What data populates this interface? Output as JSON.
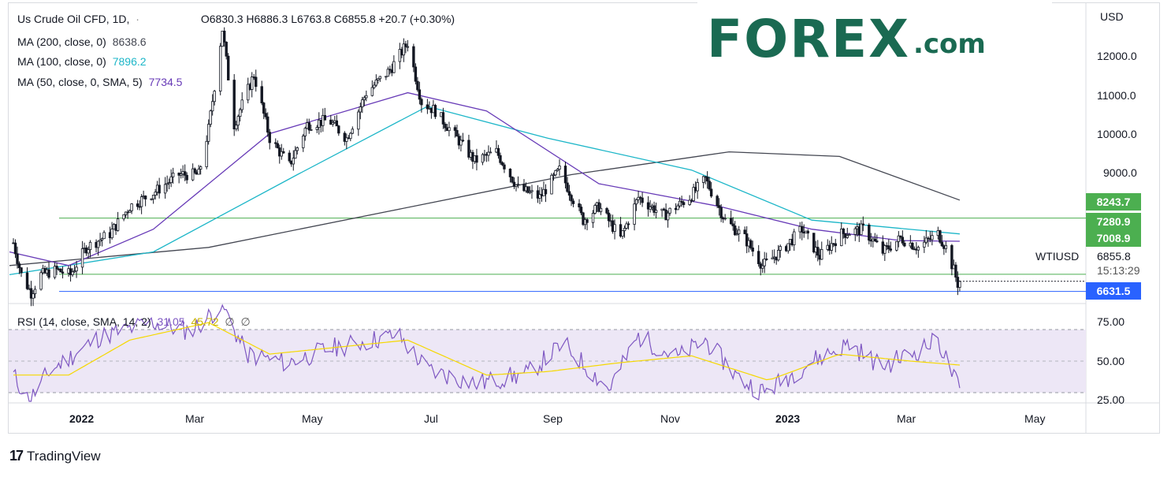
{
  "header": {
    "symbol": "Us Crude Oil CFD, 1D,",
    "dot": "·",
    "ohlc": "O6830.3  H6886.3  L6763.8  C6855.8  +20.7 (+0.30%)"
  },
  "indicators": [
    {
      "label": "MA (200, close, 0)",
      "value": "8638.6",
      "color": "#434651"
    },
    {
      "label": "MA (100, close, 0)",
      "value": "7896.2",
      "color": "#1cb6c8"
    },
    {
      "label": "MA (50, close, 0, SMA, 5)",
      "value": "7734.5",
      "color": "#673ab7"
    }
  ],
  "rsi_legend": {
    "label": "RSI (14, close, SMA, 14, 2)",
    "v1": "31.05",
    "v2": "45.72",
    "v3": "∅",
    "v4": "∅"
  },
  "brand": {
    "logo": "FOREX",
    "suffix": ".com",
    "color": "#1a6a52"
  },
  "axis": {
    "currency": "USD",
    "price_ticks": [
      "12000.0",
      "11000.0",
      "10000.0",
      "9000.0"
    ],
    "rsi_ticks": [
      "75.00",
      "50.00",
      "25.00"
    ],
    "time_ticks": [
      "2022",
      "Mar",
      "May",
      "Jul",
      "Sep",
      "Nov",
      "2023",
      "Mar",
      "May"
    ]
  },
  "price_boxes": [
    {
      "label": "8243.7",
      "color": "#4caf50"
    },
    {
      "label": "7280.9",
      "color": "#4caf50"
    },
    {
      "label": "7008.9",
      "color": "#4caf50"
    },
    {
      "label": "6631.5",
      "color": "#2962ff"
    }
  ],
  "last_price": {
    "symbol": "WTIUSD",
    "price": "6855.8",
    "countdown": "15:13:29"
  },
  "footer": {
    "brand": "TradingView"
  },
  "chart_data": {
    "type": "candlestick",
    "timeframe": "1D",
    "y_range": [
      6400,
      12900
    ],
    "x_range": [
      "2021-11-20",
      "2023-05-20"
    ],
    "horizontal_levels": [
      {
        "value": 8243.7,
        "color": "#4caf50"
      },
      {
        "value": 7008.9,
        "color": "#4caf50"
      },
      {
        "value": 6631.5,
        "color": "#2962ff"
      }
    ],
    "close_path": [
      [
        "2021-11-22",
        7700
      ],
      [
        "2021-11-26",
        7000
      ],
      [
        "2021-12-01",
        6600
      ],
      [
        "2021-12-06",
        7000
      ],
      [
        "2021-12-14",
        7100
      ],
      [
        "2021-12-21",
        7000
      ],
      [
        "2021-12-29",
        7600
      ],
      [
        "2022-01-10",
        7900
      ],
      [
        "2022-01-20",
        8500
      ],
      [
        "2022-02-01",
        8800
      ],
      [
        "2022-02-14",
        9200
      ],
      [
        "2022-02-24",
        9200
      ],
      [
        "2022-03-01",
        10200
      ],
      [
        "2022-03-08",
        12400
      ],
      [
        "2022-03-14",
        10300
      ],
      [
        "2022-03-24",
        11400
      ],
      [
        "2022-04-01",
        10000
      ],
      [
        "2022-04-11",
        9400
      ],
      [
        "2022-04-20",
        10300
      ],
      [
        "2022-05-01",
        10400
      ],
      [
        "2022-05-10",
        10000
      ],
      [
        "2022-05-20",
        11000
      ],
      [
        "2022-06-01",
        11500
      ],
      [
        "2022-06-10",
        12100
      ],
      [
        "2022-06-17",
        10800
      ],
      [
        "2022-06-24",
        10600
      ],
      [
        "2022-07-05",
        10000
      ],
      [
        "2022-07-14",
        9500
      ],
      [
        "2022-07-25",
        9700
      ],
      [
        "2022-08-05",
        8900
      ],
      [
        "2022-08-16",
        8700
      ],
      [
        "2022-08-26",
        9300
      ],
      [
        "2022-09-07",
        8200
      ],
      [
        "2022-09-15",
        8500
      ],
      [
        "2022-09-26",
        7800
      ],
      [
        "2022-10-05",
        8700
      ],
      [
        "2022-10-18",
        8300
      ],
      [
        "2022-10-31",
        8700
      ],
      [
        "2022-11-08",
        9100
      ],
      [
        "2022-11-18",
        8200
      ],
      [
        "2022-11-28",
        7800
      ],
      [
        "2022-12-07",
        7200
      ],
      [
        "2022-12-16",
        7500
      ],
      [
        "2022-12-27",
        8000
      ],
      [
        "2023-01-05",
        7400
      ],
      [
        "2023-01-16",
        7900
      ],
      [
        "2023-01-27",
        8000
      ],
      [
        "2023-02-06",
        7500
      ],
      [
        "2023-02-15",
        7800
      ],
      [
        "2023-02-24",
        7600
      ],
      [
        "2023-03-06",
        7900
      ],
      [
        "2023-03-10",
        7600
      ],
      [
        "2023-03-14",
        7100
      ],
      [
        "2023-03-16",
        6800
      ],
      [
        "2023-03-17",
        6855.8
      ]
    ],
    "ma200": [
      [
        "2021-11-20",
        7200
      ],
      [
        "2022-03-01",
        7600
      ],
      [
        "2022-06-01",
        8400
      ],
      [
        "2022-09-01",
        9200
      ],
      [
        "2022-11-20",
        9700
      ],
      [
        "2023-01-15",
        9600
      ],
      [
        "2023-03-17",
        8638.6
      ]
    ],
    "ma100": [
      [
        "2021-11-20",
        7000
      ],
      [
        "2022-02-01",
        7500
      ],
      [
        "2022-04-15",
        9200
      ],
      [
        "2022-06-20",
        10700
      ],
      [
        "2022-08-20",
        10000
      ],
      [
        "2022-11-01",
        9300
      ],
      [
        "2023-01-01",
        8200
      ],
      [
        "2023-03-17",
        7896.2
      ]
    ],
    "ma50": [
      [
        "2021-11-20",
        7500
      ],
      [
        "2021-12-20",
        7200
      ],
      [
        "2022-02-01",
        8000
      ],
      [
        "2022-04-01",
        10100
      ],
      [
        "2022-06-10",
        11000
      ],
      [
        "2022-07-20",
        10600
      ],
      [
        "2022-09-15",
        9000
      ],
      [
        "2022-11-15",
        8500
      ],
      [
        "2023-01-01",
        8000
      ],
      [
        "2023-02-15",
        7750
      ],
      [
        "2023-03-17",
        7734.5
      ]
    ],
    "rsi": {
      "range": [
        25,
        80
      ],
      "levels": [
        70,
        50,
        30
      ],
      "series": [
        {
          "name": "RSI",
          "color": "#7e57c2",
          "points": [
            [
              "2021-11-22",
              40
            ],
            [
              "2021-11-30",
              25
            ],
            [
              "2021-12-10",
              42
            ],
            [
              "2022-01-05",
              62
            ],
            [
              "2022-02-01",
              70
            ],
            [
              "2022-02-20",
              65
            ],
            [
              "2022-03-08",
              80
            ],
            [
              "2022-03-20",
              52
            ],
            [
              "2022-04-10",
              47
            ],
            [
              "2022-05-01",
              55
            ],
            [
              "2022-06-05",
              63
            ],
            [
              "2022-06-20",
              43
            ],
            [
              "2022-07-15",
              35
            ],
            [
              "2022-08-10",
              41
            ],
            [
              "2022-08-28",
              58
            ],
            [
              "2022-09-20",
              32
            ],
            [
              "2022-10-05",
              62
            ],
            [
              "2022-10-25",
              50
            ],
            [
              "2022-11-08",
              60
            ],
            [
              "2022-11-25",
              38
            ],
            [
              "2022-12-08",
              30
            ],
            [
              "2023-01-01",
              48
            ],
            [
              "2023-01-20",
              58
            ],
            [
              "2023-02-05",
              45
            ],
            [
              "2023-02-20",
              52
            ],
            [
              "2023-03-06",
              60
            ],
            [
              "2023-03-17",
              31.05
            ]
          ]
        },
        {
          "name": "RSI-MA",
          "color": "#f5d800",
          "points": [
            [
              "2021-11-22",
              40
            ],
            [
              "2021-12-20",
              40
            ],
            [
              "2022-01-20",
              60
            ],
            [
              "2022-03-01",
              70
            ],
            [
              "2022-04-01",
              52
            ],
            [
              "2022-06-10",
              60
            ],
            [
              "2022-07-20",
              40
            ],
            [
              "2022-08-20",
              42
            ],
            [
              "2022-09-25",
              47
            ],
            [
              "2022-11-01",
              51
            ],
            [
              "2022-12-10",
              37
            ],
            [
              "2023-01-15",
              52
            ],
            [
              "2023-02-20",
              48
            ],
            [
              "2023-03-17",
              45.72
            ]
          ]
        }
      ]
    }
  }
}
